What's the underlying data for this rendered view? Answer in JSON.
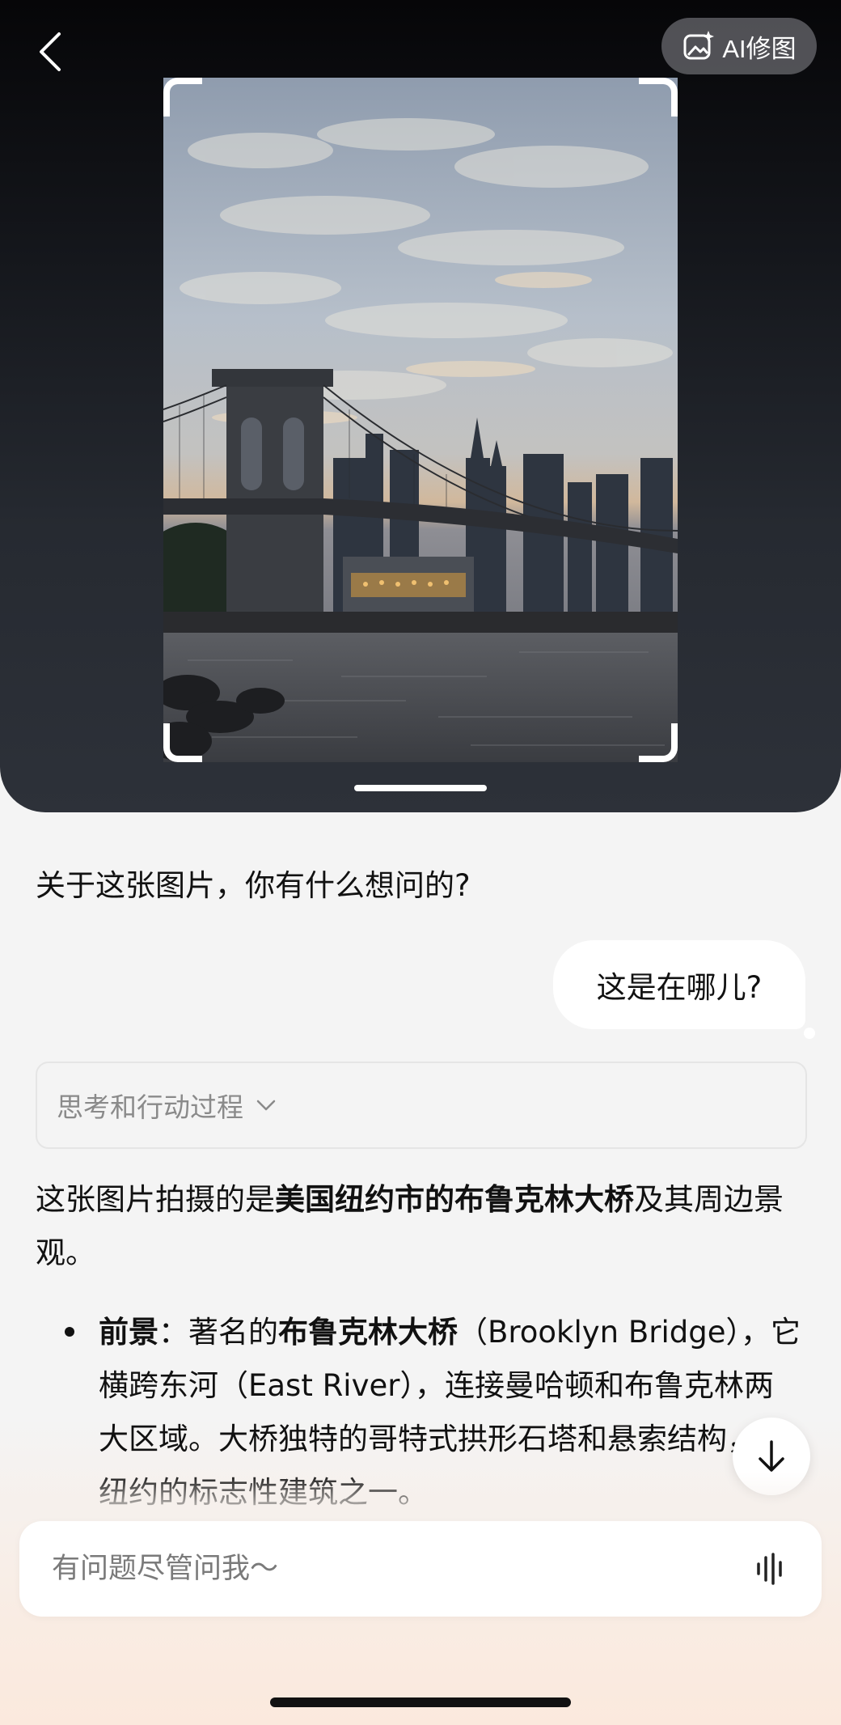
{
  "header": {
    "back_icon": "chevron-left-icon",
    "ai_edit_label": "AI修图",
    "ai_edit_icon": "image-sparkle-icon"
  },
  "photo": {
    "subject_icon": "photo-brooklyn-bridge"
  },
  "chat": {
    "assistant_prompt": "关于这张图片，你有什么想问的?",
    "user_message": "这是在哪儿?",
    "thinking_label": "思考和行动过程",
    "answer_intro_prefix": "这张图片拍摄的是",
    "answer_intro_bold": "美国纽约市的布鲁克林大桥",
    "answer_intro_suffix": "及其周边景观。",
    "bullet_1_heading": "前景",
    "bullet_1_part1": "：著名的",
    "bullet_1_bold": "布鲁克林大桥",
    "bullet_1_part2": "（Brooklyn Bridge），它横跨东河（East River），连接曼哈顿和布鲁克林两大区域。大桥独特的哥特式拱形石塔和悬索结构，是纽约的标志性建筑之一。"
  },
  "input": {
    "placeholder": "有问题尽管问我～"
  },
  "colors": {
    "accent_dark": "#111111",
    "bubble": "#ffffff",
    "muted_text": "#8a8a8a"
  }
}
